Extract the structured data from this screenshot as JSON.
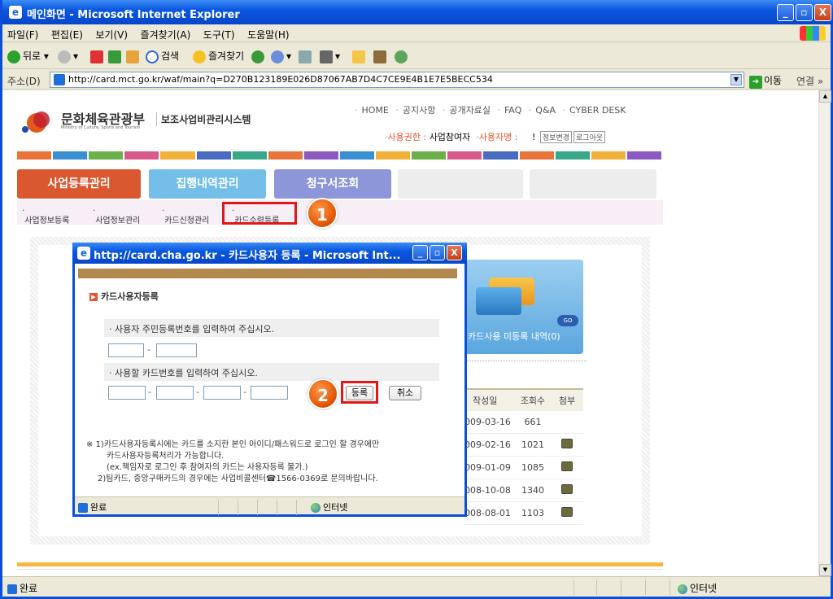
{
  "window": {
    "title": "메인화면 - Microsoft Internet Explorer",
    "minimize": "_",
    "maximize": "▫",
    "close": "X"
  },
  "menu": [
    "파일(F)",
    "편집(E)",
    "보기(V)",
    "즐겨찾기(A)",
    "도구(T)",
    "도움말(H)"
  ],
  "toolbar": {
    "back": "뒤로",
    "search": "검색",
    "favorites": "즐겨찾기"
  },
  "address": {
    "label": "주소(D)",
    "url": "http://card.mct.go.kr/waf/main?q=D270B123189E026D87067AB7D4C7CE9E4B1E7E5BECC534",
    "go": "이동",
    "links": "연결 »"
  },
  "site": {
    "org_name": "문화체육관광부",
    "org_sub": "Ministry of Culture, Sports and Tourism",
    "system_name": "보조사업비관리시스템",
    "top_nav": [
      "HOME",
      "공지사항",
      "공개자료실",
      "FAQ",
      "Q&A",
      "CYBER DESK"
    ],
    "user_perm_label": "사용권한 :",
    "user_perm_value": "사업참여자",
    "user_name_label": "사용자명 :",
    "user_name_value": "!",
    "btn_info_change": "정보변경",
    "btn_logout": "로그아웃",
    "tabs": [
      "사업등록관리",
      "집행내역관리",
      "청구서조회"
    ],
    "subnav": [
      "사업정보등록",
      "사업정보관리",
      "카드신청관리",
      "카드수령등록"
    ],
    "card_panel_text": "카드사용 미등록 내역(0)",
    "go_badge": "GO",
    "table_headers": [
      "작성일",
      "조회수",
      "첨부"
    ],
    "table_rows": [
      {
        "date": "009-03-16",
        "views": "661",
        "attach": false
      },
      {
        "date": "009-02-16",
        "views": "1021",
        "attach": true
      },
      {
        "date": "009-01-09",
        "views": "1085",
        "attach": true
      },
      {
        "date": "008-10-08",
        "views": "1340",
        "attach": true
      },
      {
        "date": "008-08-01",
        "views": "1103",
        "attach": true
      }
    ]
  },
  "markers": [
    "1",
    "2"
  ],
  "popup": {
    "title": "http://card.cha.go.kr - 카드사용자 등록 - Microsoft Int...",
    "heading": "카드사용자등록",
    "row1": "· 사용자 주민등록번호를 입력하여 주십시오.",
    "row2": "· 사용할 카드번호를 입력하여 주십시오.",
    "dash": "-",
    "register": "등록",
    "cancel": "취소",
    "note_line1": "※ 1)카드사용자등록시에는 카드를 소지한 본인 아이디/패스워드로 로그인 할 경우에만",
    "note_line2": "카드사용자등록처리가 가능합니다.",
    "note_line3": "(ex.책임자로 로그인 후 참여자의 카드는 사용자등록 불가.)",
    "note_line4": "2)팀카드, 중앙구매카드의 경우에는 사업비콜센터☎1566-0369로 문의바랍니다.",
    "status_done": "완료",
    "status_zone": "인터넷"
  },
  "status": {
    "done": "완료",
    "zone": "인터넷"
  },
  "colors": {
    "titlebar": "#0A58E0",
    "tab_active": "#D9582F",
    "tab_2": "#74BEEA",
    "tab_3": "#8C96D8",
    "highlight_box": "#e01818",
    "marker": "#e65a0a"
  }
}
